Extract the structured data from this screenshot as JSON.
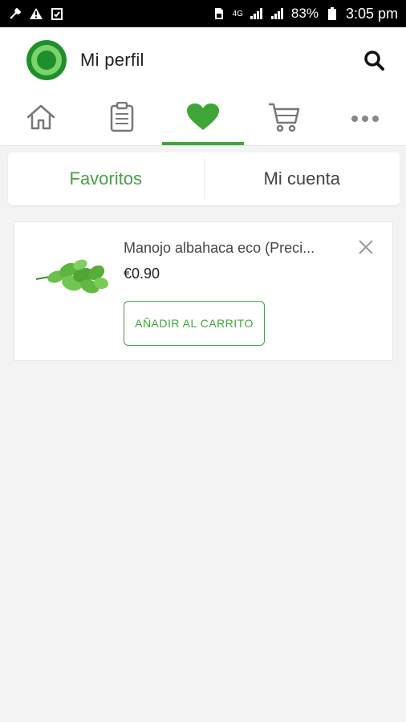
{
  "status_bar": {
    "battery": "83%",
    "time": "3:05 pm",
    "network": "4G",
    "icons": [
      "wrench-icon",
      "alert-icon",
      "clipboard-check-icon",
      "sim-icon",
      "signal-icon",
      "signal-icon",
      "battery-icon"
    ]
  },
  "header": {
    "title": "Mi perfil",
    "logo_icon": "logo-ring-icon",
    "search_icon": "search-icon"
  },
  "nav_tabs": [
    {
      "name": "home",
      "icon": "home-icon",
      "active": false
    },
    {
      "name": "orders",
      "icon": "clipboard-icon",
      "active": false
    },
    {
      "name": "favorites",
      "icon": "heart-icon",
      "active": true
    },
    {
      "name": "cart",
      "icon": "cart-icon",
      "active": false
    },
    {
      "name": "more",
      "icon": "more-dots-icon",
      "active": false
    }
  ],
  "segment": {
    "favorites_label": "Favoritos",
    "account_label": "Mi cuenta",
    "active": "favorites"
  },
  "favorites": {
    "items": [
      {
        "name": "Manojo albahaca eco (Preci...",
        "price": "€0.90",
        "add_to_cart_label": "AÑADIR AL CARRITO"
      }
    ]
  },
  "colors": {
    "accent": "#3ea638",
    "accent_text": "#4a9e46",
    "background": "#f3f3f3"
  }
}
